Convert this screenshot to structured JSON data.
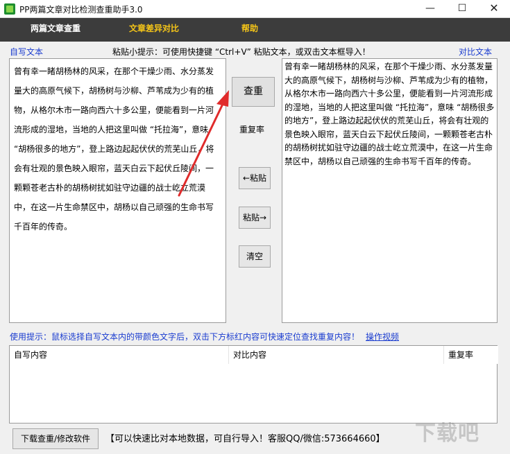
{
  "window": {
    "title": "PP两篇文章对比检测查重助手3.0",
    "min": "—",
    "max": "☐",
    "close": "✕"
  },
  "menu": {
    "items": [
      "两篇文章查重",
      "文章差异对比",
      "帮助"
    ]
  },
  "labels": {
    "self_text": "自写文本",
    "compare_text": "对比文本",
    "paste_tip": "粘贴小提示：可使用快捷键 “Ctrl+V” 粘贴文本，或双击文本框导入！",
    "rate": "重复率"
  },
  "left_text": "曾有幸一睹胡杨林的风采，在那个干燥少雨、水分蒸发量大的高原气候下，胡杨树与沙柳、芦苇成为少有的植物，从格尔木市一路向西六十多公里，便能看到一片河流形成的湿地，当地的人把这里叫做 “托拉海”，意味 “胡杨很多的地方”，登上路边起起伏伏的荒芜山丘，将会有壮观的景色映入眼帘，蓝天白云下起伏丘陵间，一颗颗苍老古朴的胡杨树扰如驻守边疆的战士屹立荒漠中，在这一片生命禁区中，胡杨以自己顽强的生命书写千百年的传奇。",
  "right_text": "曾有幸一睹胡杨林的风采，在那个干燥少雨、水分蒸发量大的高原气候下，胡杨树与沙柳、芦苇成为少有的植物，从格尔木市一路向西六十多公里，便能看到一片河流形成的湿地，当地的人把这里叫做 “托拉海”，意味 “胡杨很多的地方”，登上路边起起伏伏的荒芜山丘，将会有壮观的景色映入眼帘，蓝天白云下起伏丘陵间，一颗颗苍老古朴的胡杨树扰如驻守边疆的战士屹立荒漠中，在这一片生命禁区中，胡杨以自己顽强的生命书写千百年的传奇。",
  "buttons": {
    "check": "查重",
    "paste_left": "←粘贴",
    "paste_right": "粘贴→",
    "clear": "清空",
    "download": "下载查重/修改软件"
  },
  "usage": {
    "tip": "使用提示：鼠标选择自写文本内的带颜色文字后，双击下方标红内容可快速定位查找重复内容！",
    "video_link": "操作视频"
  },
  "table": {
    "columns": [
      "自写内容",
      "对比内容",
      "重复率"
    ]
  },
  "footer": {
    "service": "【可以快速比对本地数据，可自行导入！客服QQ/微信:573664660】"
  },
  "watermark": "下载吧",
  "colors": {
    "menubar": "#3c3c3c",
    "menu_active": "#f5c518",
    "link_blue": "#1a3ccf",
    "arrow_red": "#e02b2b"
  }
}
